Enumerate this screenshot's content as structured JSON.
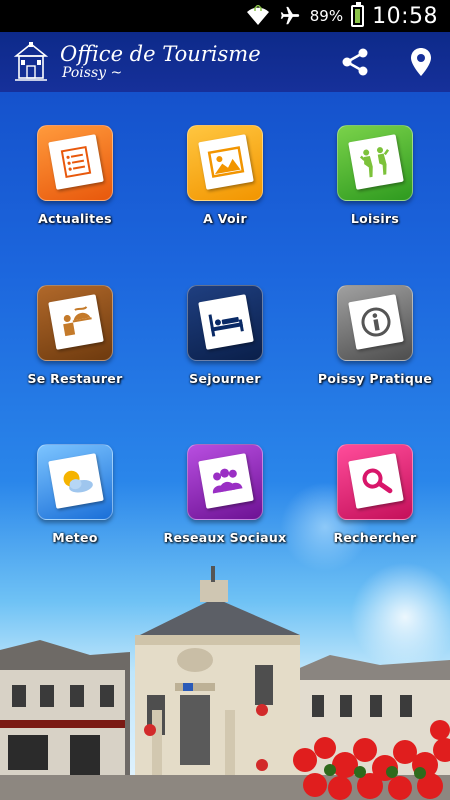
{
  "status_bar": {
    "battery_percent": "89%",
    "time": "10:58",
    "icons": [
      "wifi-icon",
      "airplane-icon",
      "battery-icon"
    ]
  },
  "app_bar": {
    "title": "Office de Tourisme",
    "subtitle": "Poissy ~",
    "actions": [
      "share-icon",
      "location-pin-icon"
    ]
  },
  "tiles": [
    {
      "label": "Actualites",
      "icon": "news-icon",
      "color": "#f06a12"
    },
    {
      "label": "A Voir",
      "icon": "picture-icon",
      "color": "#f7a50a"
    },
    {
      "label": "Loisirs",
      "icon": "leisure-people-icon",
      "color": "#3fae2a"
    },
    {
      "label": "Se Restaurer",
      "icon": "restaurant-icon",
      "color": "#8a4a17"
    },
    {
      "label": "Sejourner",
      "icon": "bed-icon",
      "color": "#0a2a66"
    },
    {
      "label": "Poissy Pratique",
      "icon": "info-icon",
      "color": "#6d6d6d"
    },
    {
      "label": "Meteo",
      "icon": "weather-icon",
      "color": "#2a8ee8"
    },
    {
      "label": "Reseaux Sociaux",
      "icon": "social-network-icon",
      "color": "#8a22b8"
    },
    {
      "label": "Rechercher",
      "icon": "search-icon",
      "color": "#e0176a"
    }
  ]
}
